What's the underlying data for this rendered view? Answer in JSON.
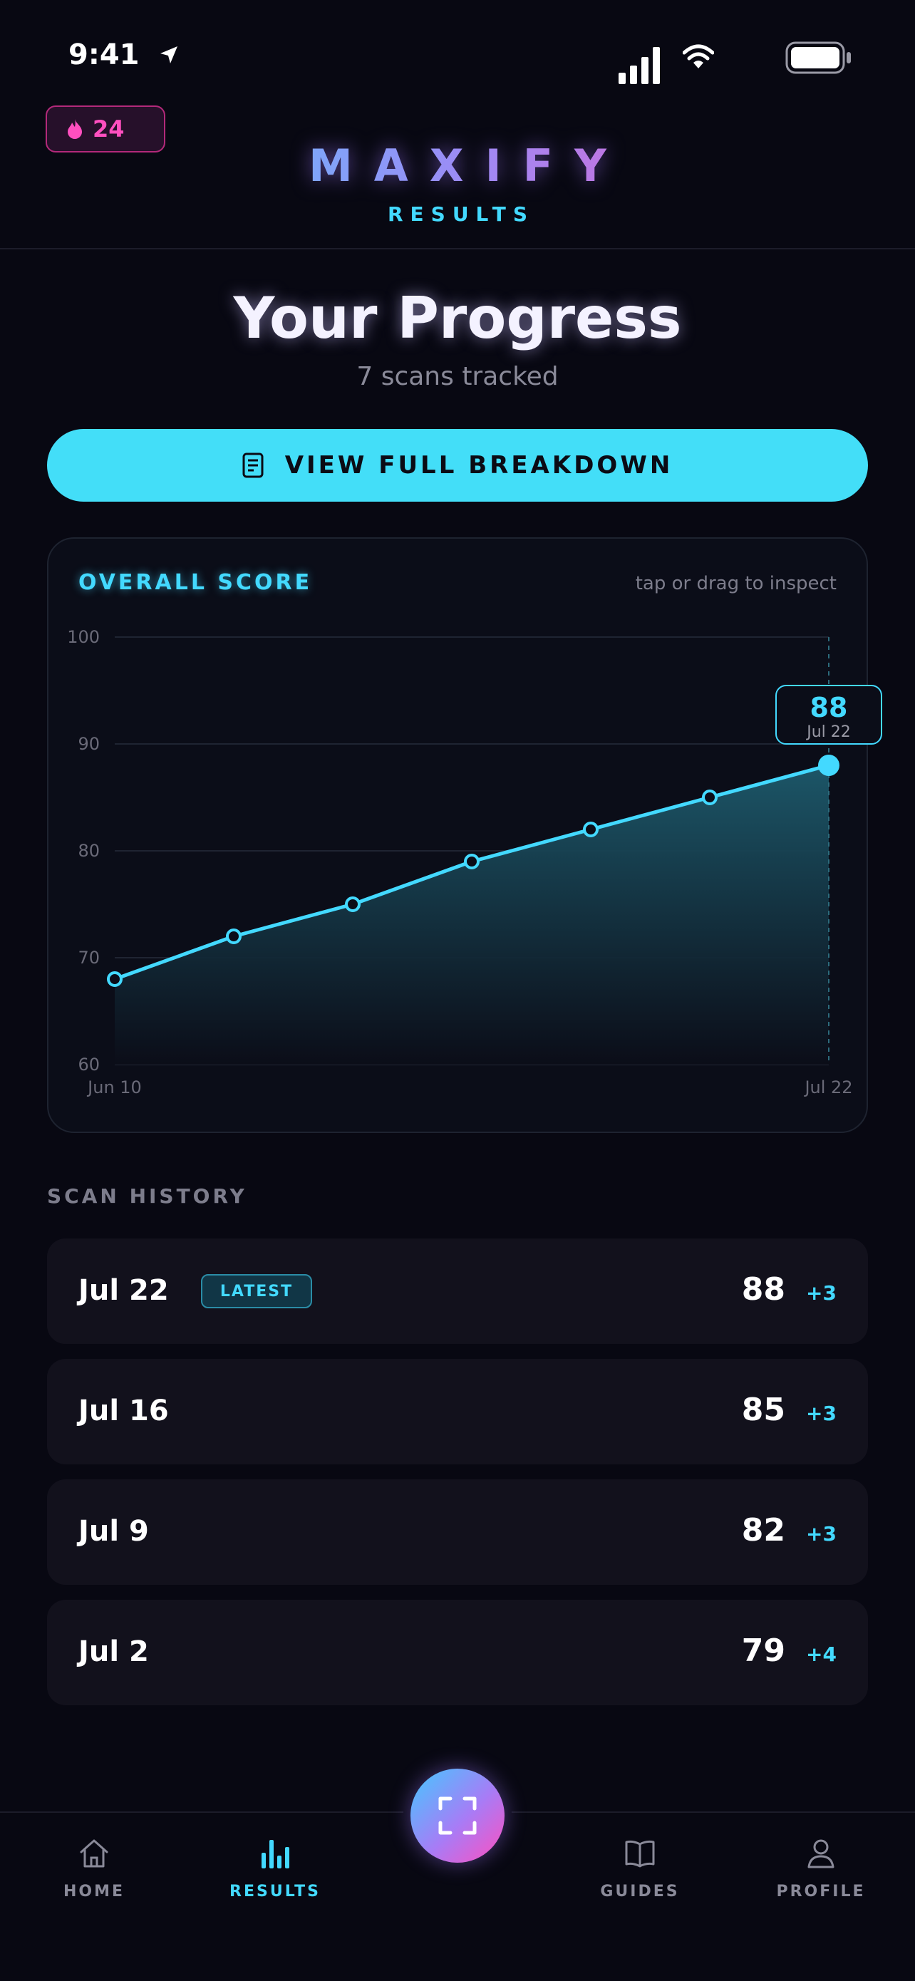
{
  "status_bar": {
    "time": "9:41"
  },
  "header": {
    "streak_count": "24",
    "brand": "MAXIFY",
    "subtitle": "RESULTS"
  },
  "main": {
    "title": "Your Progress",
    "scans_tracked": "7 scans tracked",
    "cta_label": "VIEW FULL BREAKDOWN"
  },
  "chart_card": {
    "title": "OVERALL SCORE",
    "hint": "tap or drag to inspect",
    "tooltip": {
      "value": "88",
      "date": "Jul 22"
    }
  },
  "chart_data": {
    "type": "line",
    "title": "OVERALL SCORE",
    "x_tick_labels": [
      "Jun 10",
      "Jul 22"
    ],
    "y_ticks": [
      100,
      90,
      80,
      70,
      60
    ],
    "ylim": [
      60,
      100
    ],
    "grid": true,
    "series": [
      {
        "values": [
          68,
          72,
          75,
          79,
          82,
          85,
          88
        ]
      }
    ],
    "colors": {
      "line": "#43d9ff",
      "area_top": "#1d5a6c"
    }
  },
  "history": {
    "title": "SCAN HISTORY",
    "rows": [
      {
        "date": "Jul 22",
        "badge": "LATEST",
        "score": "88",
        "delta": "+3"
      },
      {
        "date": "Jul 16",
        "badge": "",
        "score": "85",
        "delta": "+3"
      },
      {
        "date": "Jul 9",
        "badge": "",
        "score": "82",
        "delta": "+3"
      },
      {
        "date": "Jul 2",
        "badge": "",
        "score": "79",
        "delta": "+4"
      }
    ]
  },
  "tabs": [
    {
      "label": "HOME",
      "icon": "home-icon",
      "active": false
    },
    {
      "label": "RESULTS",
      "icon": "bar-chart-icon",
      "active": true
    },
    {
      "label": "GUIDES",
      "icon": "book-icon",
      "active": false
    },
    {
      "label": "PROFILE",
      "icon": "person-icon",
      "active": false
    }
  ],
  "colors": {
    "accent": "#43d9ff",
    "pink": "#ff4fbf",
    "background": "#080812",
    "muted": "#7d7d8c"
  }
}
